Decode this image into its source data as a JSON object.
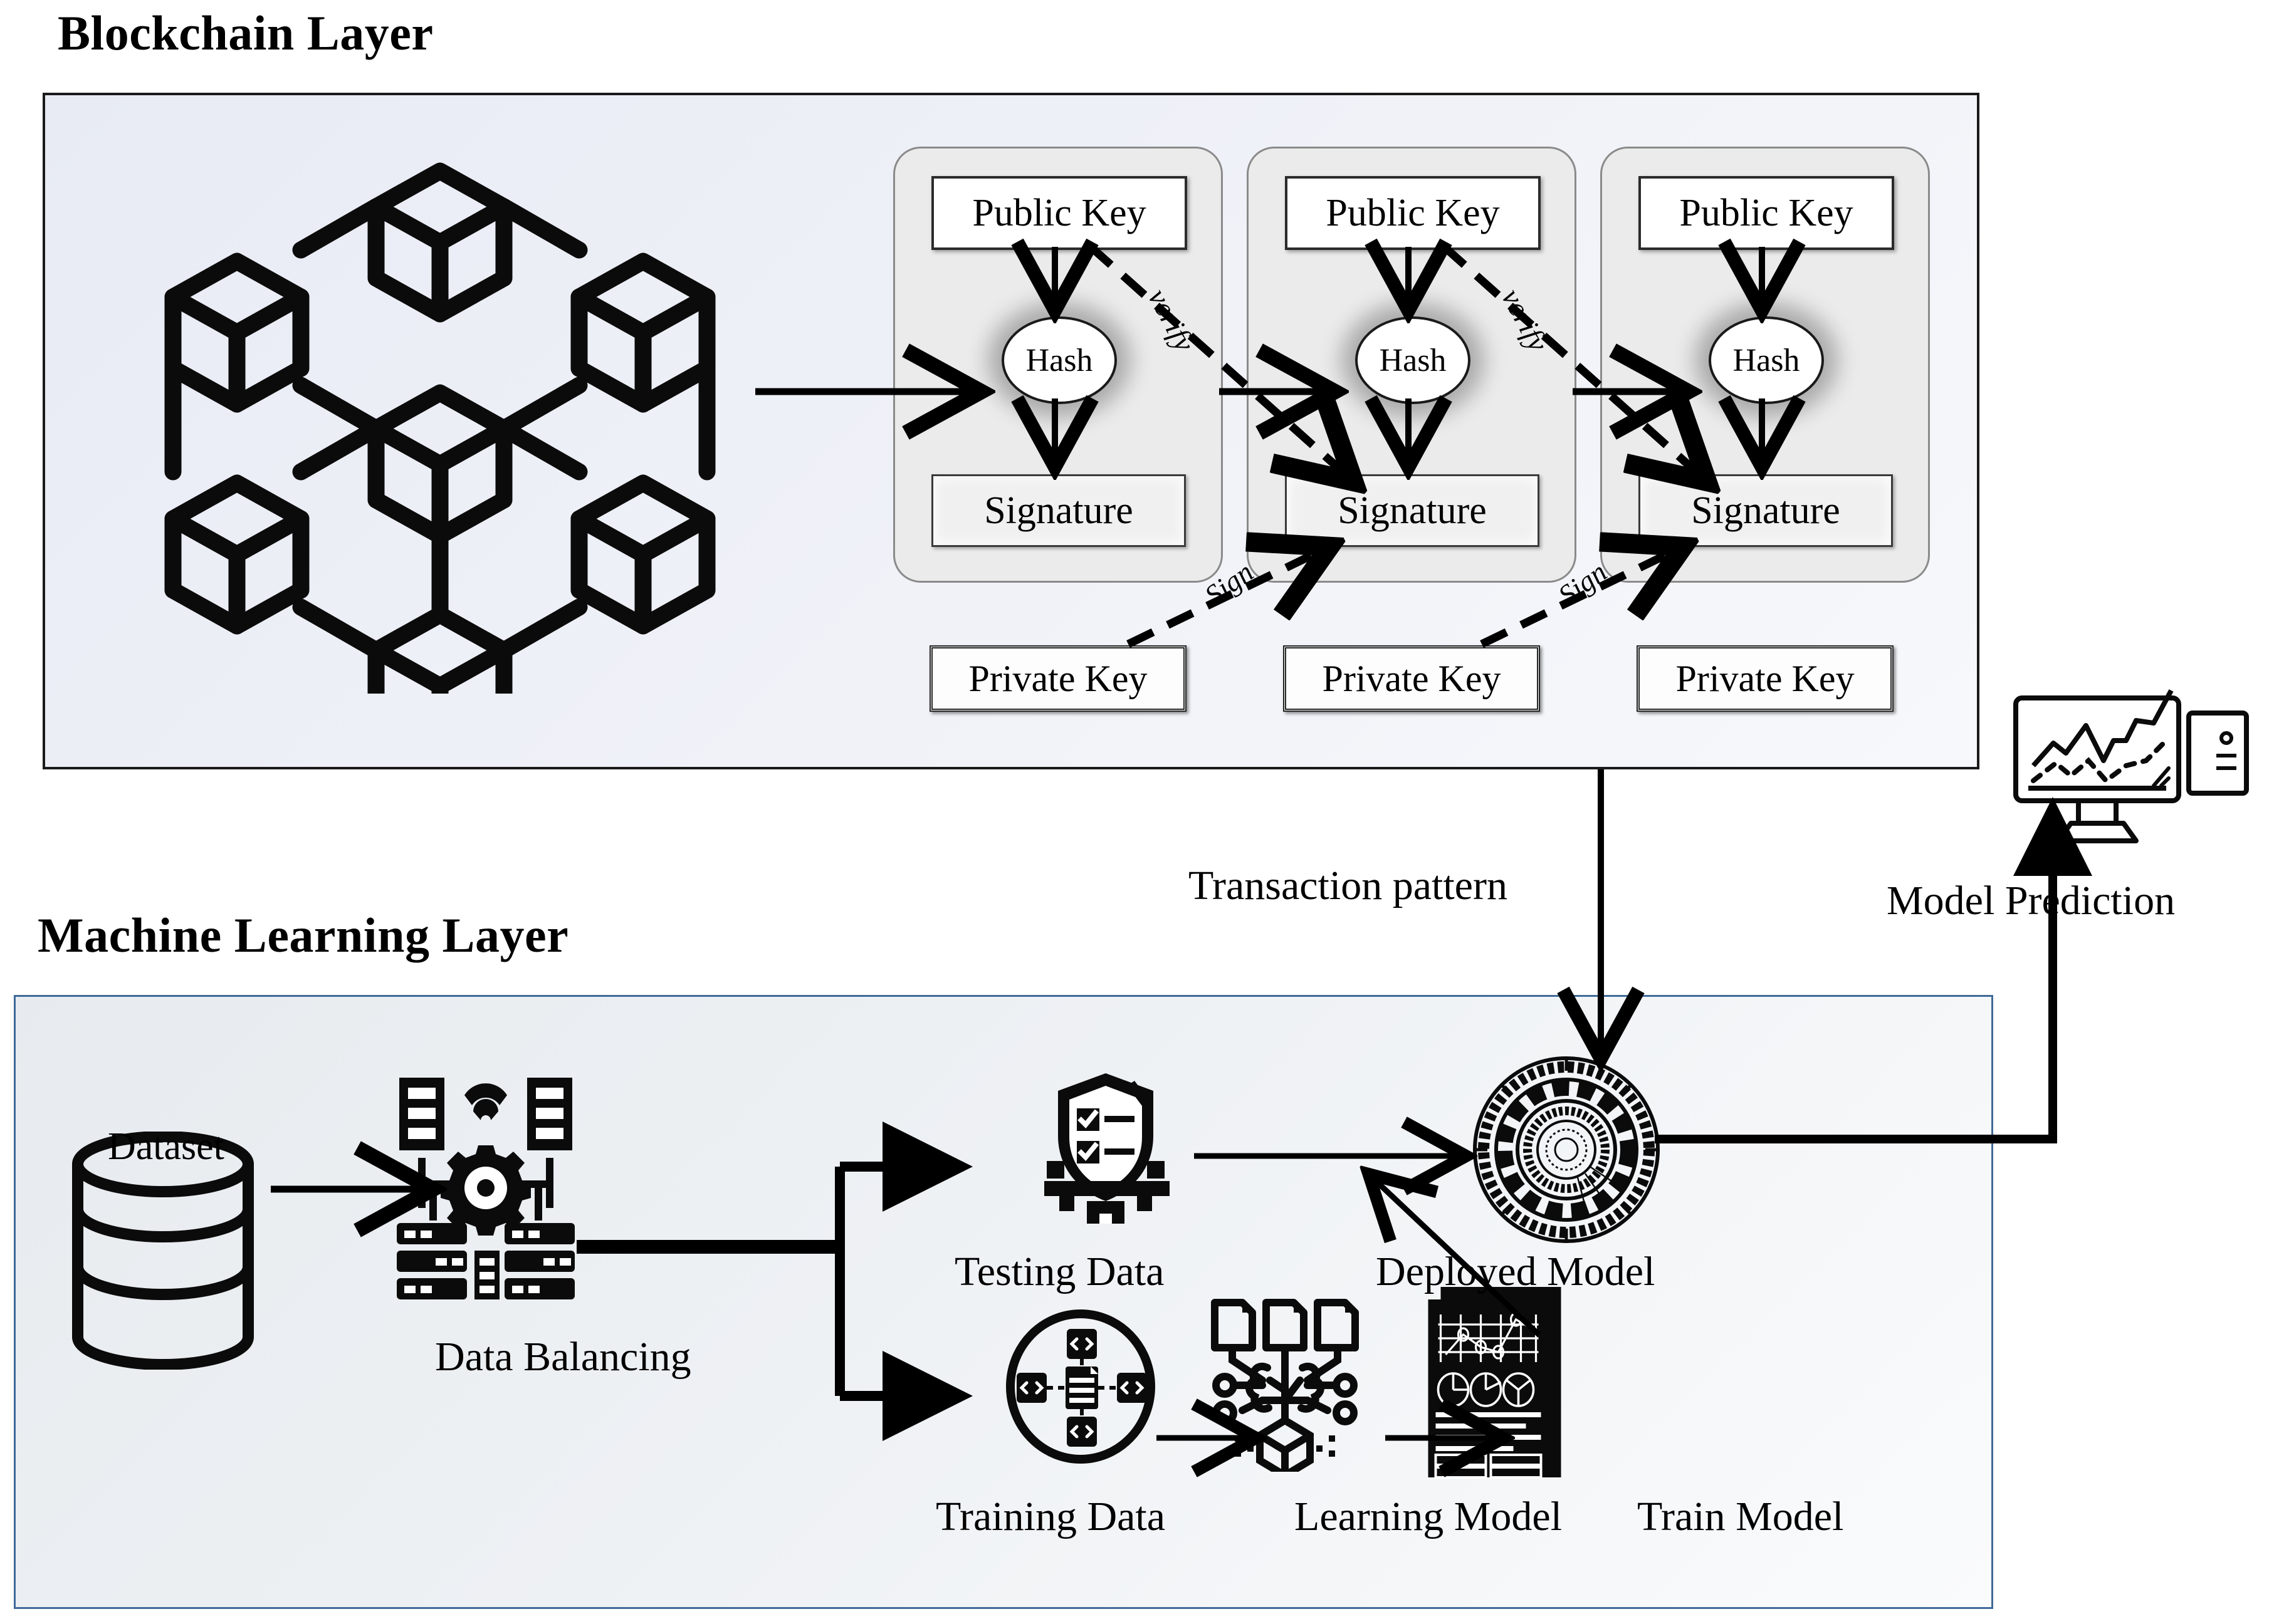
{
  "layers": {
    "blockchain": {
      "title": "Blockchain Layer"
    },
    "ml": {
      "title": "Machine Learning Layer"
    }
  },
  "blockchain": {
    "network_icon": "blockchain-cube-network-icon",
    "blocks": [
      {
        "public_key": "Public Key",
        "hash": "Hash",
        "signature": "Signature",
        "private_key": "Private Key"
      },
      {
        "public_key": "Public Key",
        "hash": "Hash",
        "signature": "Signature",
        "private_key": "Private Key"
      },
      {
        "public_key": "Public Key",
        "hash": "Hash",
        "signature": "Signature",
        "private_key": "Private Key"
      }
    ],
    "edges": {
      "verify_1": "verify",
      "verify_2": "verify",
      "sign_1": "Sign",
      "sign_2": "Sign"
    }
  },
  "connector": {
    "transaction_pattern": "Transaction pattern"
  },
  "ml": {
    "nodes": [
      {
        "label": "Dataset",
        "icon": "database-cylinder-icon"
      },
      {
        "label": "Data Balancing",
        "icon": "server-gear-network-icon"
      },
      {
        "label": "Testing Data",
        "icon": "shield-checklist-gear-icon"
      },
      {
        "label": "Training Data",
        "icon": "code-nodes-circle-icon"
      },
      {
        "label": "Learning Model",
        "icon": "brain-neural-documents-icon"
      },
      {
        "label": "Train Model",
        "icon": "report-charts-document-icon"
      },
      {
        "label": "Deployed Model",
        "icon": "radial-hud-dial-icon"
      }
    ]
  },
  "output": {
    "label": "Model Prediction",
    "icon": "monitor-chart-desktop-icon"
  },
  "colors": {
    "blockchain_border": "#1a1a1a",
    "ml_border": "#3f6a98",
    "panel_fill_blockchain": "#eef0f7",
    "panel_fill_ml": "#eef1f4",
    "card_fill": "#ebebeb",
    "ink": "#000000"
  }
}
